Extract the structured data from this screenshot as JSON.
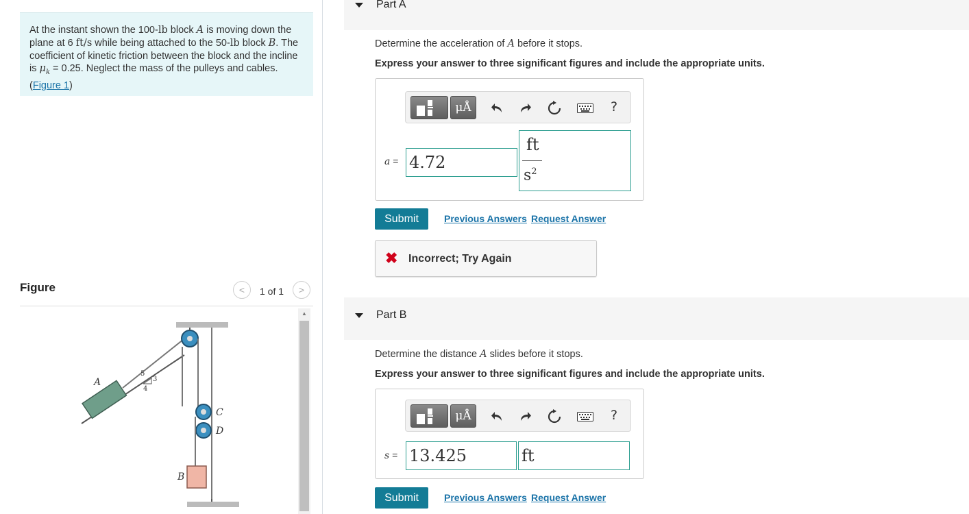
{
  "problem": {
    "t1": "At the instant shown the 100-",
    "u1": "lb",
    "t2": " block ",
    "v1": "A",
    "t3": " is moving down the plane at 6 ",
    "u2": "ft/s",
    "t4": " while being attached to the 50-",
    "u3": "lb",
    "t5": " block ",
    "v2": "B",
    "t6": ". The coefficient of kinetic friction between the block and the incline is ",
    "mu": "μ",
    "mu_sub": "k",
    "t7": " = 0.25. Neglect the mass of the pulleys and cables. (",
    "figure_link": "Figure 1",
    "t8": ")"
  },
  "figure": {
    "title": "Figure",
    "count": "1 of 1",
    "prev_icon": "chevron-left-icon",
    "next_icon": "chevron-right-icon",
    "labels": {
      "A": "A",
      "B": "B",
      "C": "C",
      "D": "D",
      "slope_5": "5",
      "slope_3": "3",
      "slope_4": "4"
    }
  },
  "part_a": {
    "title": "Part A",
    "question_pre": "Determine the acceleration of ",
    "question_var": "A",
    "question_post": " before it stops.",
    "instruction": "Express your answer to three significant figures and include the appropriate units.",
    "toolbar": {
      "units_label": "μÅ",
      "help_label": "?"
    },
    "var_name": "a",
    "equals": " =",
    "value": "4.72",
    "unit_num": "ft",
    "unit_den": "s",
    "unit_den_exp": "2",
    "submit_label": "Submit",
    "previous_answers_label": "Previous Answers",
    "request_answer_label": "Request Answer",
    "feedback_icon": "✖",
    "feedback_text": "Incorrect; Try Again"
  },
  "part_b": {
    "title": "Part B",
    "question_pre": "Determine the distance ",
    "question_var": "A",
    "question_post": " slides before it stops.",
    "instruction": "Express your answer to three significant figures and include the appropriate units.",
    "toolbar": {
      "units_label": "μÅ",
      "help_label": "?"
    },
    "var_name": "s",
    "equals": " =",
    "value": "13.425",
    "unit": "ft",
    "submit_label": "Submit",
    "previous_answers_label": "Previous Answers",
    "request_answer_label": "Request Answer"
  },
  "colors": {
    "problem_bg": "#e6f6f8",
    "submit_bg": "#137c96",
    "link": "#1a73a8",
    "input_border": "#2a9d8f",
    "error": "#d0021b",
    "block_a": "#6f9e8a",
    "block_b": "#f0b6a6",
    "pulley": "#3b8fbf"
  }
}
